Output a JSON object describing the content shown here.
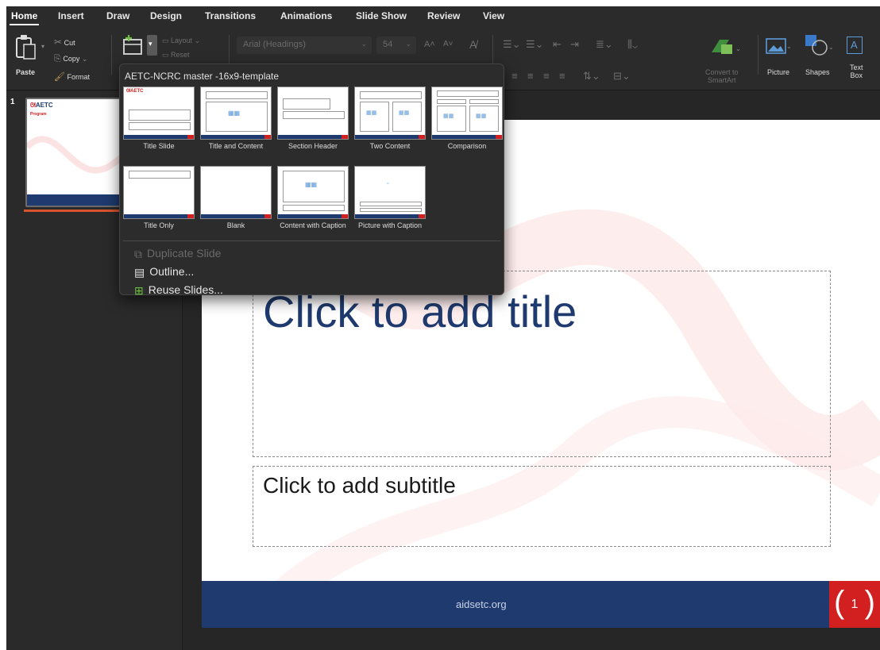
{
  "tabs": [
    "Home",
    "Insert",
    "Draw",
    "Design",
    "Transitions",
    "Animations",
    "Slide Show",
    "Review",
    "View"
  ],
  "active_tab": "Home",
  "ribbon": {
    "paste_label": "Paste",
    "cut_label": "Cut",
    "copy_label": "Copy",
    "format_label": "Format",
    "layout_label": "Layout",
    "reset_label": "Reset",
    "font_name": "Arial (Headings)",
    "font_size": "54",
    "convert_to_label": "Convert to",
    "smartart_label": "SmartArt",
    "picture_label": "Picture",
    "shapes_label": "Shapes",
    "text_label": "Text",
    "box_label": "Box"
  },
  "layout_menu": {
    "header": "AETC-NCRC master -16x9-template",
    "layouts": [
      {
        "label": "Title Slide"
      },
      {
        "label": "Title and Content"
      },
      {
        "label": "Section Header"
      },
      {
        "label": "Two Content"
      },
      {
        "label": "Comparison"
      },
      {
        "label": "Title Only"
      },
      {
        "label": "Blank"
      },
      {
        "label": "Content with Caption"
      },
      {
        "label": "Picture with Caption"
      }
    ],
    "duplicate_label": "Duplicate Slide",
    "outline_label": "Outline...",
    "reuse_label": "Reuse Slides..."
  },
  "thumbnails": {
    "slide_number": "1",
    "logo_text": "AETC",
    "logo_sub": "Program"
  },
  "slide": {
    "title_placeholder": "Click to add title",
    "subtitle_placeholder": "Click to add subtitle",
    "footer_text": "aidsetc.org",
    "slide_number": "1"
  },
  "colors": {
    "app_bg": "#262626",
    "ribbon_bg": "#2b2b2b",
    "navy": "#1e3a6e",
    "red": "#d21f1f",
    "accent_orange": "#d9542e"
  }
}
